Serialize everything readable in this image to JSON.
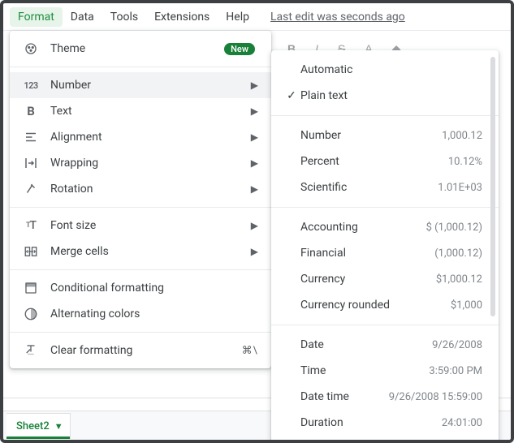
{
  "menubar": {
    "items": [
      "Format",
      "Data",
      "Tools",
      "Extensions",
      "Help"
    ],
    "open_index": 0,
    "last_edit": "Last edit was seconds ago"
  },
  "format_menu": {
    "items": [
      {
        "label": "Theme",
        "badge": "New"
      },
      {
        "label": "Number",
        "arrow": true,
        "highlight": true
      },
      {
        "label": "Text",
        "arrow": true
      },
      {
        "label": "Alignment",
        "arrow": true
      },
      {
        "label": "Wrapping",
        "arrow": true
      },
      {
        "label": "Rotation",
        "arrow": true
      },
      {
        "label": "Font size",
        "arrow": true
      },
      {
        "label": "Merge cells",
        "arrow": true
      },
      {
        "label": "Conditional formatting"
      },
      {
        "label": "Alternating colors"
      },
      {
        "label": "Clear formatting",
        "shortcut": "⌘\\"
      }
    ]
  },
  "number_submenu": {
    "sections": [
      [
        {
          "label": "Automatic"
        },
        {
          "label": "Plain text",
          "checked": true
        }
      ],
      [
        {
          "label": "Number",
          "example": "1,000.12"
        },
        {
          "label": "Percent",
          "example": "10.12%"
        },
        {
          "label": "Scientific",
          "example": "1.01E+03"
        }
      ],
      [
        {
          "label": "Accounting",
          "example": "$ (1,000.12)"
        },
        {
          "label": "Financial",
          "example": "(1,000.12)"
        },
        {
          "label": "Currency",
          "example": "$1,000.12"
        },
        {
          "label": "Currency rounded",
          "example": "$1,000"
        }
      ],
      [
        {
          "label": "Date",
          "example": "9/26/2008"
        },
        {
          "label": "Time",
          "example": "3:59:00 PM"
        },
        {
          "label": "Date time",
          "example": "9/26/2008 15:59:00"
        },
        {
          "label": "Duration",
          "example": "24:01:00"
        }
      ]
    ]
  },
  "sheet_tab": {
    "name": "Sheet2"
  }
}
